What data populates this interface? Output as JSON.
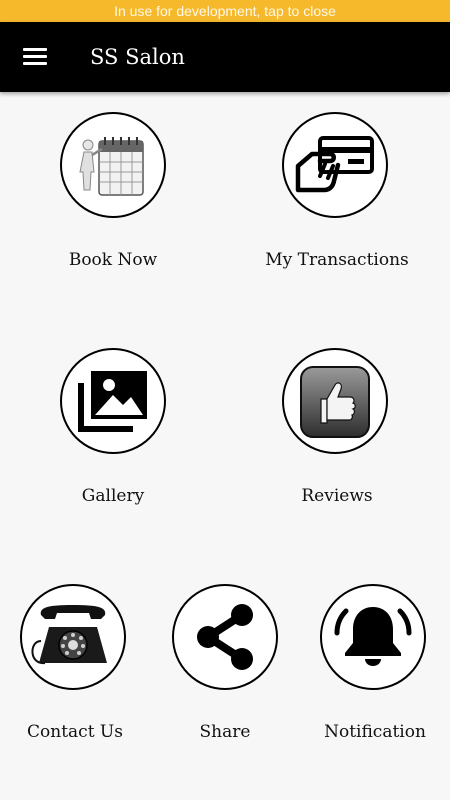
{
  "dev_banner": {
    "text": "In use for development, tap to close"
  },
  "app_bar": {
    "title": "SS Salon",
    "menu_icon": "hamburger-menu-icon"
  },
  "tiles": [
    {
      "label": "Book Now",
      "icon": "calendar-person-icon"
    },
    {
      "label": "My Transactions",
      "icon": "credit-card-hand-icon"
    },
    {
      "label": "Gallery",
      "icon": "image-gallery-icon"
    },
    {
      "label": "Reviews",
      "icon": "thumbs-up-icon"
    },
    {
      "label": "Contact Us",
      "icon": "rotary-telephone-icon"
    },
    {
      "label": "Share",
      "icon": "share-icon"
    },
    {
      "label": "Notification",
      "icon": "bell-icon"
    }
  ],
  "colors": {
    "banner": "#f6b92b",
    "app_bar": "#000000",
    "background": "#f7f7f7",
    "icon": "#000000"
  }
}
